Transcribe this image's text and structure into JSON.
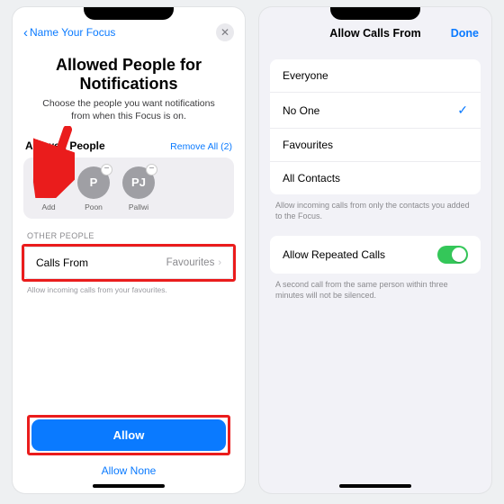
{
  "left": {
    "back_label": "Name Your Focus",
    "title": "Allowed People for Notifications",
    "subtitle": "Choose the people you want notifications from when this Focus is on.",
    "allowed_section": {
      "label": "Allowed People",
      "remove_all": "Remove All (2)",
      "add_label": "Add",
      "people": [
        {
          "initial": "P",
          "name": "Poon"
        },
        {
          "initial": "PJ",
          "name": "Pallwi"
        }
      ]
    },
    "other_header": "OTHER PEOPLE",
    "calls_row": {
      "label": "Calls From",
      "value": "Favourites"
    },
    "calls_hint": "Allow incoming calls from your favourites.",
    "allow_label": "Allow",
    "allow_none_label": "Allow None"
  },
  "right": {
    "title": "Allow Calls From",
    "done": "Done",
    "options": [
      "Everyone",
      "No One",
      "Favourites",
      "All Contacts"
    ],
    "selected_index": 1,
    "group_note": "Allow incoming calls from only the contacts you added to the Focus.",
    "repeated_label": "Allow Repeated Calls",
    "repeated_note": "A second call from the same person within three minutes will not be silenced."
  }
}
